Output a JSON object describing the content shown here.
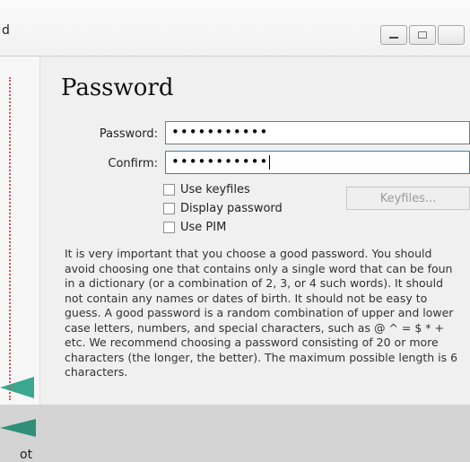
{
  "window": {
    "title_fragment": "d"
  },
  "page": {
    "heading": "Password",
    "password_label": "Password:",
    "password_value": "•••••••••••",
    "confirm_label": "Confirm:",
    "confirm_value": "•••••••••••",
    "checkboxes": [
      {
        "label": "Use keyfiles",
        "checked": false
      },
      {
        "label": "Display password",
        "checked": false
      },
      {
        "label": "Use PIM",
        "checked": false
      }
    ],
    "keyfiles_button": "Keyfiles...",
    "info_lines": [
      "It is very important that you choose a good password. You should",
      "avoid choosing one that contains only a single word that can be foun",
      "in a dictionary (or a combination of 2, 3, or 4 such words). It should",
      "not contain any names or dates of birth. It should not be easy to",
      "guess. A good password is a random combination of upper and lower",
      "case letters, numbers, and special characters, such as @ ^ = $ * +",
      "etc. We recommend choosing a password consisting of 20 or more",
      "characters (the longer, the better). The maximum possible length is 6",
      "characters."
    ]
  },
  "left_strip": {
    "cut_text": "ot"
  },
  "colors": {
    "accent_teal": "#3aa88e",
    "dotted_red": "#d9534f"
  }
}
